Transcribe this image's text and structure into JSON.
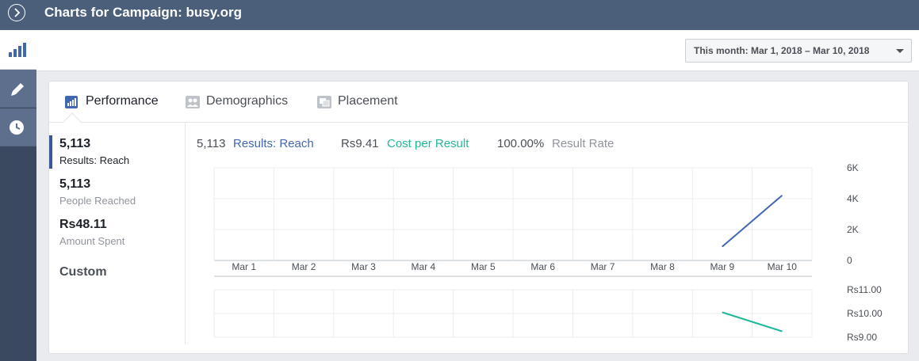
{
  "header": {
    "title": "Charts for Campaign: busy.org"
  },
  "nav": {
    "icons": [
      "bar-chart-icon",
      "pencil-icon",
      "clock-icon"
    ]
  },
  "date_range": {
    "label": "This month: Mar 1, 2018 – Mar 10, 2018"
  },
  "tabs": [
    {
      "label": "Performance",
      "icon": "bar-chart-icon",
      "active": true
    },
    {
      "label": "Demographics",
      "icon": "people-icon",
      "active": false
    },
    {
      "label": "Placement",
      "icon": "placement-icon",
      "active": false
    }
  ],
  "metrics": [
    {
      "value": "5,113",
      "label": "Results: Reach",
      "active": true
    },
    {
      "value": "5,113",
      "label": "People Reached",
      "active": false
    },
    {
      "value": "Rs48.11",
      "label": "Amount Spent",
      "active": false
    }
  ],
  "custom_label": "Custom",
  "summary": [
    {
      "value": "5,113",
      "label": "Results: Reach",
      "color": "#4267b2"
    },
    {
      "value": "Rs9.41",
      "label": "Cost per Result",
      "color": "#1fb89a"
    },
    {
      "value": "100.00%",
      "label": "Result Rate",
      "color": "#90949c"
    }
  ],
  "chart_data": [
    {
      "type": "line",
      "categories": [
        "Mar 1",
        "Mar 2",
        "Mar 3",
        "Mar 4",
        "Mar 5",
        "Mar 6",
        "Mar 7",
        "Mar 8",
        "Mar 9",
        "Mar 10"
      ],
      "series": [
        {
          "values": [
            null,
            null,
            null,
            null,
            null,
            null,
            null,
            null,
            900,
            4213
          ],
          "color": "#4267b2"
        }
      ],
      "y_ticks": [
        "6K",
        "4K",
        "2K",
        "0"
      ],
      "ylim": [
        0,
        6000
      ],
      "grid": true
    },
    {
      "type": "line",
      "categories": [
        "Mar 1",
        "Mar 2",
        "Mar 3",
        "Mar 4",
        "Mar 5",
        "Mar 6",
        "Mar 7",
        "Mar 8",
        "Mar 9",
        "Mar 10"
      ],
      "series": [
        {
          "values": [
            null,
            null,
            null,
            null,
            null,
            null,
            null,
            null,
            10.05,
            9.25
          ],
          "color": "#1fb89a"
        }
      ],
      "y_ticks": [
        "Rs11.00",
        "Rs10.00",
        "Rs9.00"
      ],
      "ylim": [
        9,
        11
      ],
      "grid": true
    }
  ]
}
